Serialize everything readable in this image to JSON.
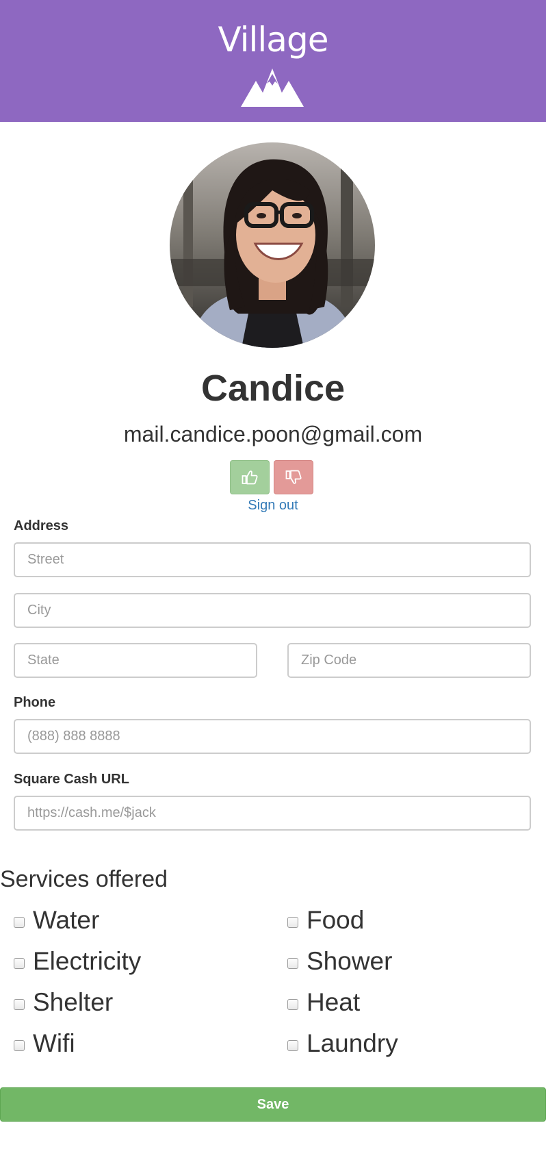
{
  "header": {
    "brand": "Village",
    "logo_icon": "mountains-icon",
    "background_color": "#8e68c1"
  },
  "profile": {
    "name": "Candice",
    "email": "mail.candice.poon@gmail.com",
    "thumbs_up_icon": "thumbs-up-icon",
    "thumbs_down_icon": "thumbs-down-icon",
    "sign_out": "Sign out"
  },
  "address": {
    "label": "Address",
    "street": {
      "value": "",
      "placeholder": "Street"
    },
    "city": {
      "value": "",
      "placeholder": "City"
    },
    "state": {
      "value": "",
      "placeholder": "State"
    },
    "zip": {
      "value": "",
      "placeholder": "Zip Code"
    }
  },
  "phone": {
    "label": "Phone",
    "value": "",
    "placeholder": "(888) 888 8888"
  },
  "square_cash": {
    "label": "Square Cash URL",
    "value": "",
    "placeholder": "https://cash.me/$jack"
  },
  "services": {
    "title": "Services offered",
    "items": [
      {
        "label": "Water",
        "checked": false
      },
      {
        "label": "Food",
        "checked": false
      },
      {
        "label": "Electricity",
        "checked": false
      },
      {
        "label": "Shower",
        "checked": false
      },
      {
        "label": "Shelter",
        "checked": false
      },
      {
        "label": "Heat",
        "checked": false
      },
      {
        "label": "Wifi",
        "checked": false
      },
      {
        "label": "Laundry",
        "checked": false
      }
    ]
  },
  "actions": {
    "save_label": "Save",
    "save_color": "#72b766"
  }
}
